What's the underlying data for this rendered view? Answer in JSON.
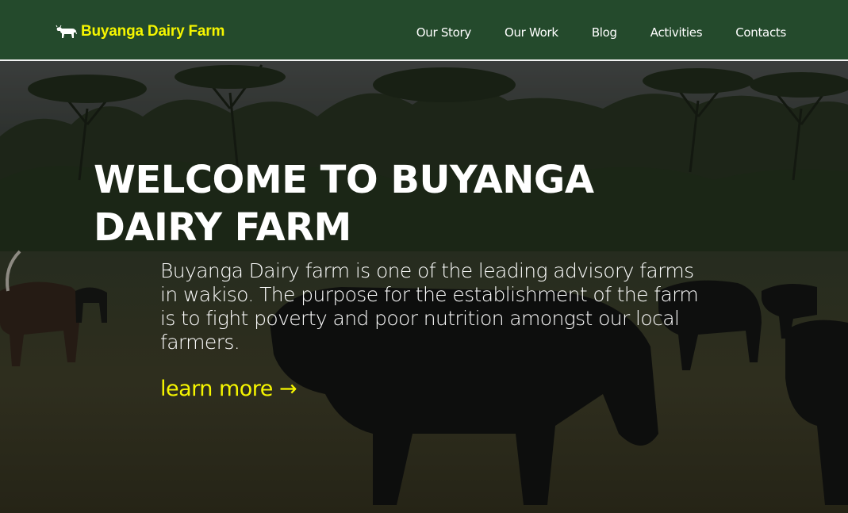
{
  "header": {
    "brand": {
      "name": "Buyanga Dairy Farm",
      "icon": "cow-icon",
      "color": "#f5f500"
    },
    "background_color": "#244a2c",
    "nav": [
      {
        "label": "Our Story"
      },
      {
        "label": "Our Work"
      },
      {
        "label": "Blog"
      },
      {
        "label": "Activities"
      },
      {
        "label": "Contacts"
      }
    ]
  },
  "hero": {
    "background": "grazing-cattle-field-photo",
    "title_line1": "WELCOME TO BUYANGA",
    "title_line2": "DAIRY FARM",
    "description": "Buyanga Dairy farm is one of the leading advisory farms in wakiso. The purpose for the establishment of the farm is to fight poverty and poor nutrition amongst our local farmers.",
    "cta_label": "learn more →",
    "cta_color": "#f5f500"
  }
}
